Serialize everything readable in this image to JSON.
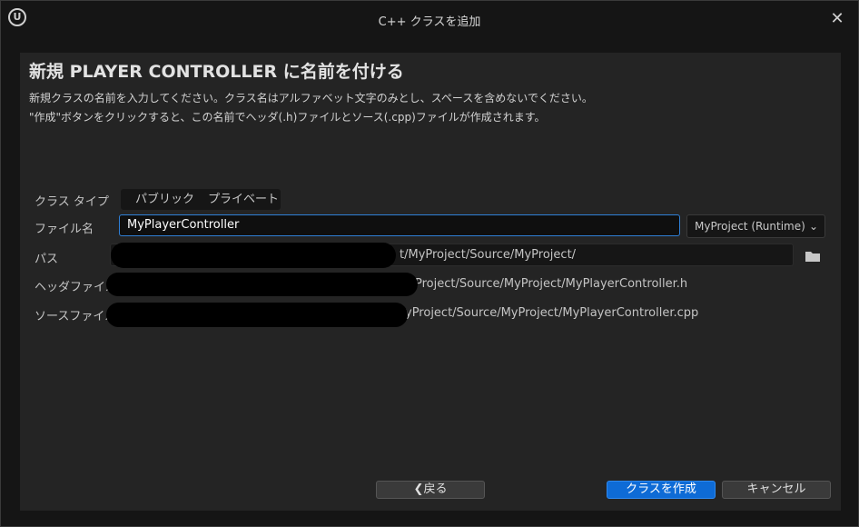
{
  "window": {
    "title": "C++ クラスを追加",
    "logo_text": "U",
    "close_glyph": "✕"
  },
  "header": {
    "heading": "新規 PLAYER CONTROLLER に名前を付ける",
    "description_line1": "新規クラスの名前を入力してください。クラス名はアルファベット文字のみとし、スペースを含めないでください。",
    "description_line2": "\"作成\"ボタンをクリックすると、この名前でヘッダ(.h)ファイルとソース(.cpp)ファイルが作成されます。"
  },
  "form": {
    "class_type_label": "クラス タイプ",
    "class_type_options": [
      "パブリック",
      "プライベート"
    ],
    "file_name_label": "ファイル名",
    "file_name_value": "MyPlayerController",
    "module_value": "MyProject (Runtime)",
    "module_chevron": "⌄",
    "path_label": "パス",
    "path_value": "t/MyProject/Source/MyProject/",
    "header_file_label": "ヘッダファイル",
    "header_file_value": "Project/Source/MyProject/MyPlayerController.h",
    "source_file_label": "ソースファイル",
    "source_file_value": "yProject/Source/MyProject/MyPlayerController.cpp"
  },
  "footer": {
    "back_label": "❮戻る",
    "create_label": "クラスを作成",
    "cancel_label": "キャンセル"
  },
  "colors": {
    "accent": "#0e6bd6",
    "focus_border": "#2f7fd6",
    "panel": "#242424",
    "background": "#151515"
  }
}
